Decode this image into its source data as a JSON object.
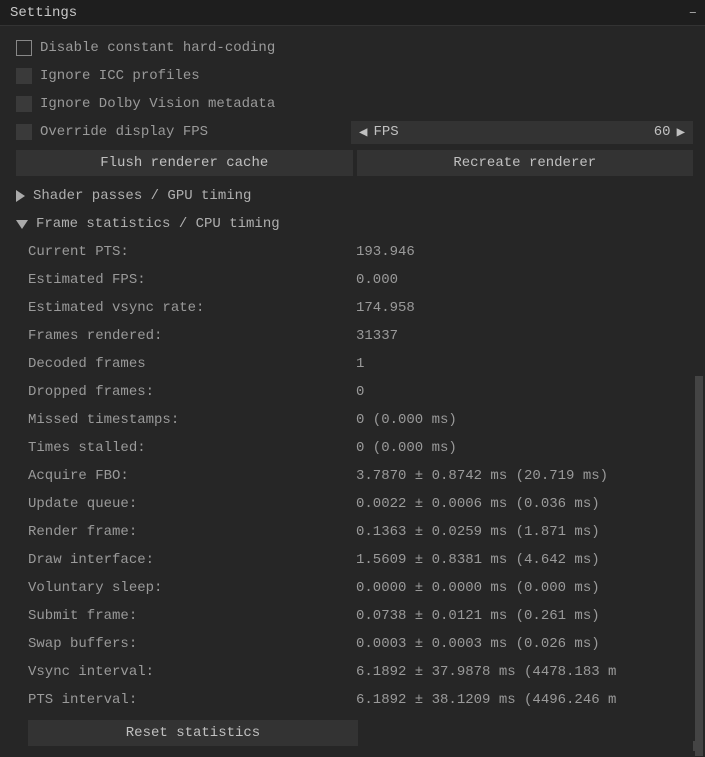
{
  "window": {
    "title": "Settings",
    "minimize": "–"
  },
  "checkboxes": {
    "disable_hardcoding": "Disable constant hard-coding",
    "ignore_icc": "Ignore ICC profiles",
    "ignore_dolby": "Ignore Dolby Vision metadata",
    "override_fps": "Override display FPS"
  },
  "fps": {
    "arrow_left": "◀",
    "name": "FPS",
    "value": "60",
    "arrow_right": "▶"
  },
  "buttons": {
    "flush": "Flush renderer cache",
    "recreate": "Recreate renderer",
    "reset_stats": "Reset statistics"
  },
  "sections": {
    "shader": "Shader passes / GPU timing",
    "frame": "Frame statistics / CPU timing"
  },
  "stats": [
    {
      "label": "Current PTS:",
      "value": "193.946"
    },
    {
      "label": "Estimated FPS:",
      "value": "0.000"
    },
    {
      "label": "Estimated vsync rate:",
      "value": "174.958"
    },
    {
      "label": "Frames rendered:",
      "value": "31337"
    },
    {
      "label": "Decoded frames",
      "value": "1"
    },
    {
      "label": "Dropped frames:",
      "value": "0"
    },
    {
      "label": "Missed timestamps:",
      "value": "0 (0.000 ms)"
    },
    {
      "label": "Times stalled:",
      "value": "0 (0.000 ms)"
    },
    {
      "label": "Acquire FBO:",
      "value": "3.7870 ± 0.8742 ms (20.719 ms)"
    },
    {
      "label": "Update queue:",
      "value": "0.0022 ± 0.0006 ms (0.036 ms)"
    },
    {
      "label": "Render frame:",
      "value": "0.1363 ± 0.0259 ms (1.871 ms)"
    },
    {
      "label": "Draw interface:",
      "value": "1.5609 ± 0.8381 ms (4.642 ms)"
    },
    {
      "label": "Voluntary sleep:",
      "value": "0.0000 ± 0.0000 ms (0.000 ms)"
    },
    {
      "label": "Submit frame:",
      "value": "0.0738 ± 0.0121 ms (0.261 ms)"
    },
    {
      "label": "Swap buffers:",
      "value": "0.0003 ± 0.0003 ms (0.026 ms)"
    },
    {
      "label": "Vsync interval:",
      "value": "6.1892 ± 37.9878 ms (4478.183 m"
    },
    {
      "label": "PTS interval:",
      "value": "6.1892 ± 38.1209 ms (4496.246 m"
    }
  ]
}
